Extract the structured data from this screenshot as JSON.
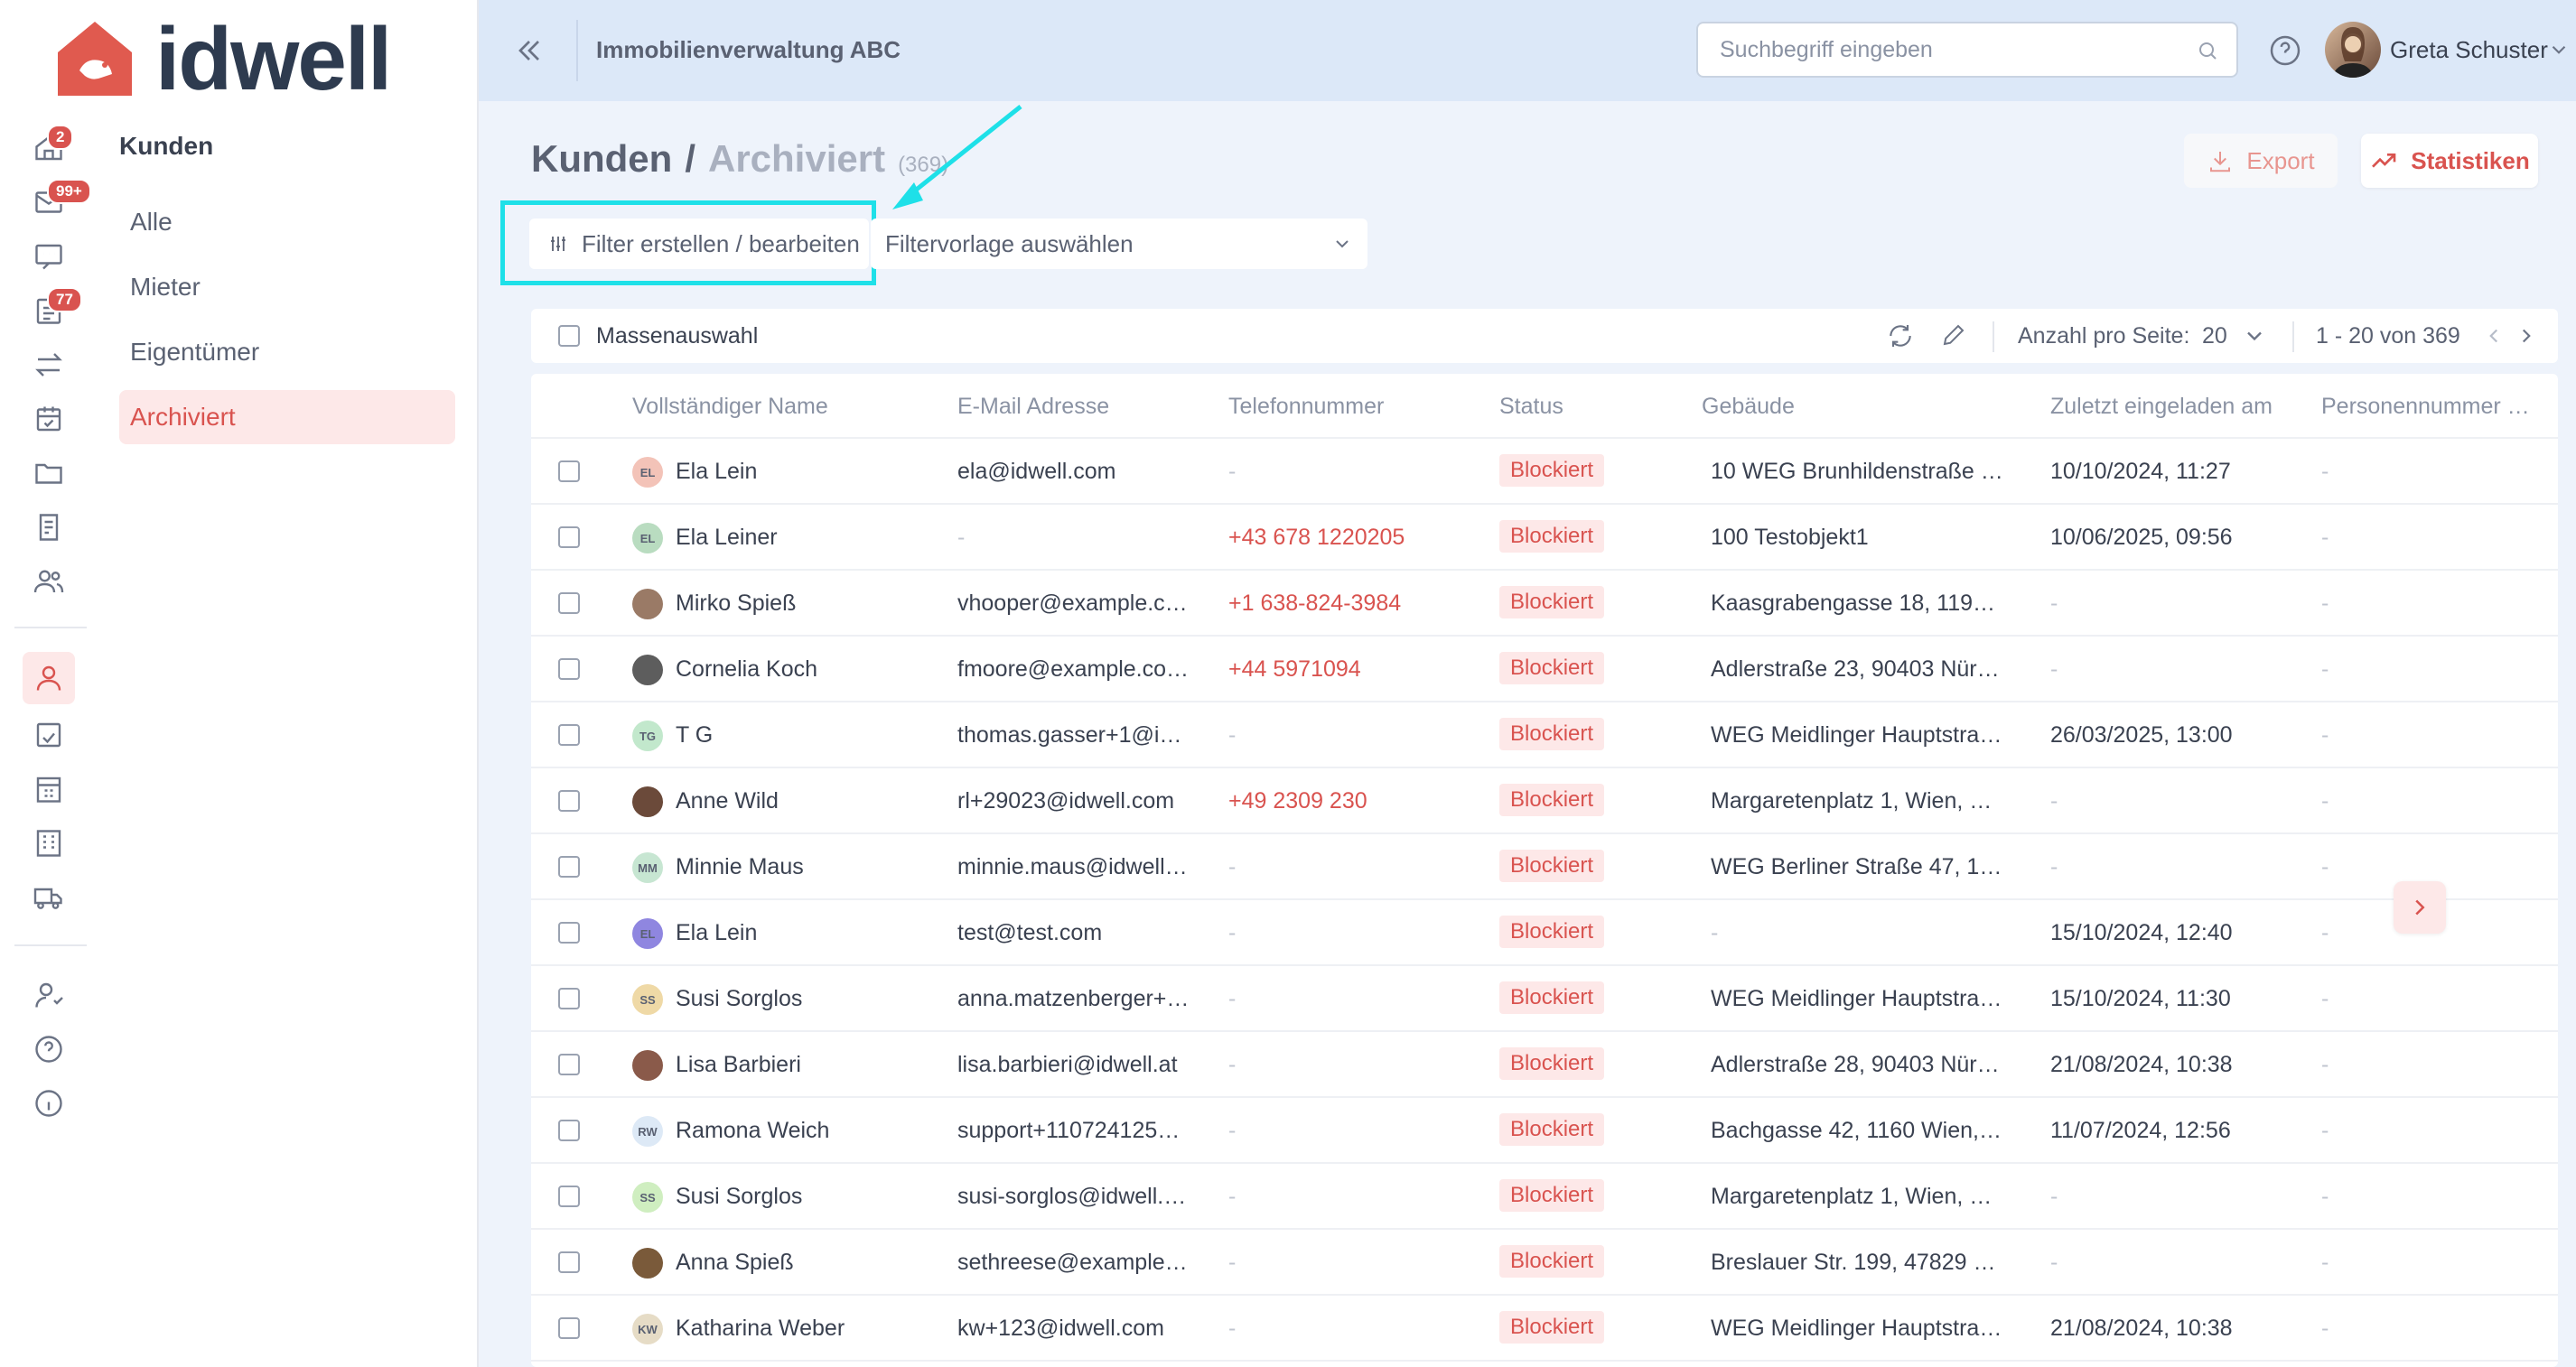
{
  "brand": {
    "name": "idwell"
  },
  "rail": {
    "badges": {
      "home": "2",
      "inbox": "99+",
      "tasks": "77"
    }
  },
  "subnav": {
    "title": "Kunden",
    "items": [
      {
        "label": "Alle",
        "active": false
      },
      {
        "label": "Mieter",
        "active": false
      },
      {
        "label": "Eigentümer",
        "active": false
      },
      {
        "label": "Archiviert",
        "active": true
      }
    ]
  },
  "topbar": {
    "org_name": "Immobilienverwaltung ABC",
    "search_placeholder": "Suchbegriff eingeben",
    "user_name": "Greta Schuster"
  },
  "header": {
    "title": "Kunden",
    "separator": "/",
    "subtitle": "Archiviert",
    "count": "(369)",
    "export_label": "Export",
    "stats_label": "Statistiken"
  },
  "filters": {
    "edit_label": "Filter erstellen / bearbeiten",
    "template_placeholder": "Filtervorlage auswählen"
  },
  "toolbar": {
    "mass_select_label": "Massenauswahl",
    "per_page_label": "Anzahl pro Seite:",
    "per_page_value": "20",
    "range_label": "1 - 20 von 369"
  },
  "table": {
    "columns": [
      "Vollständiger Name",
      "E-Mail Adresse",
      "Telefonnummer",
      "Status",
      "Gebäude",
      "Zuletzt eingeladen am",
      "Personennummer …"
    ],
    "rows": [
      {
        "initials": "EL",
        "avatar_color": "#f3c3b8",
        "name": "Ela Lein",
        "email": "ela@idwell.com",
        "phone": "-",
        "status": "Blockiert",
        "building": "10 WEG Brunhildenstraße …",
        "invited": "10/10/2024, 11:27",
        "person_no": "-"
      },
      {
        "initials": "EL",
        "avatar_color": "#b9dcc0",
        "name": "Ela Leiner",
        "email": "-",
        "phone": "+43 678 1220205",
        "status": "Blockiert",
        "building": "100 Testobjekt1",
        "invited": "10/06/2025, 09:56",
        "person_no": "-"
      },
      {
        "initials": "",
        "avatar_color": "#9a7a66",
        "name": "Mirko Spieß",
        "email": "vhooper@example.c…",
        "phone": "+1 638-824-3984",
        "status": "Blockiert",
        "building": "Kaasgrabengasse 18, 119…",
        "invited": "-",
        "person_no": "-"
      },
      {
        "initials": "",
        "avatar_color": "#5d5d5d",
        "name": "Cornelia Koch",
        "email": "fmoore@example.co…",
        "phone": "+44 5971094",
        "status": "Blockiert",
        "building": "Adlerstraße 23, 90403 Nür…",
        "invited": "-",
        "person_no": "-"
      },
      {
        "initials": "TG",
        "avatar_color": "#c2e8cc",
        "name": "T G",
        "email": "thomas.gasser+1@i…",
        "phone": "-",
        "status": "Blockiert",
        "building": "WEG Meidlinger Hauptstra…",
        "invited": "26/03/2025, 13:00",
        "person_no": "-"
      },
      {
        "initials": "",
        "avatar_color": "#6b4a3a",
        "name": "Anne Wild",
        "email": "rl+29023@idwell.com",
        "phone": "+49 2309 230",
        "status": "Blockiert",
        "building": "Margaretenplatz 1, Wien, …",
        "invited": "-",
        "person_no": "-"
      },
      {
        "initials": "MM",
        "avatar_color": "#c7e6d2",
        "name": "Minnie Maus",
        "email": "minnie.maus@idwell…",
        "phone": "-",
        "status": "Blockiert",
        "building": "WEG Berliner Straße 47, 1…",
        "invited": "-",
        "person_no": "-"
      },
      {
        "initials": "EL",
        "avatar_color": "#8f86e0",
        "name": "Ela Lein",
        "email": "test@test.com",
        "phone": "-",
        "status": "Blockiert",
        "building": "-",
        "invited": "15/10/2024, 12:40",
        "person_no": "-"
      },
      {
        "initials": "SS",
        "avatar_color": "#efd9a6",
        "name": "Susi Sorglos",
        "email": "anna.matzenberger+…",
        "phone": "-",
        "status": "Blockiert",
        "building": "WEG Meidlinger Hauptstra…",
        "invited": "15/10/2024, 11:30",
        "person_no": "-"
      },
      {
        "initials": "",
        "avatar_color": "#8a5a4a",
        "name": "Lisa Barbieri",
        "email": "lisa.barbieri@idwell.at",
        "phone": "-",
        "status": "Blockiert",
        "building": "Adlerstraße 28, 90403 Nür…",
        "invited": "21/08/2024, 10:38",
        "person_no": "-"
      },
      {
        "initials": "RW",
        "avatar_color": "#dde9f6",
        "name": "Ramona Weich",
        "email": "support+110724125…",
        "phone": "-",
        "status": "Blockiert",
        "building": "Bachgasse 42, 1160 Wien,…",
        "invited": "11/07/2024, 12:56",
        "person_no": "-"
      },
      {
        "initials": "SS",
        "avatar_color": "#cfeec0",
        "name": "Susi Sorglos",
        "email": "susi-sorglos@idwell.…",
        "phone": "-",
        "status": "Blockiert",
        "building": "Margaretenplatz 1, Wien, …",
        "invited": "-",
        "person_no": "-"
      },
      {
        "initials": "",
        "avatar_color": "#7a5a3a",
        "name": "Anna Spieß",
        "email": "sethreese@example…",
        "phone": "-",
        "status": "Blockiert",
        "building": "Breslauer Str. 199, 47829 …",
        "invited": "-",
        "person_no": "-"
      },
      {
        "initials": "KW",
        "avatar_color": "#e6dcc6",
        "name": "Katharina Weber",
        "email": "kw+123@idwell.com",
        "phone": "-",
        "status": "Blockiert",
        "building": "WEG Meidlinger Hauptstra…",
        "invited": "21/08/2024, 10:38",
        "person_no": "-"
      }
    ]
  }
}
